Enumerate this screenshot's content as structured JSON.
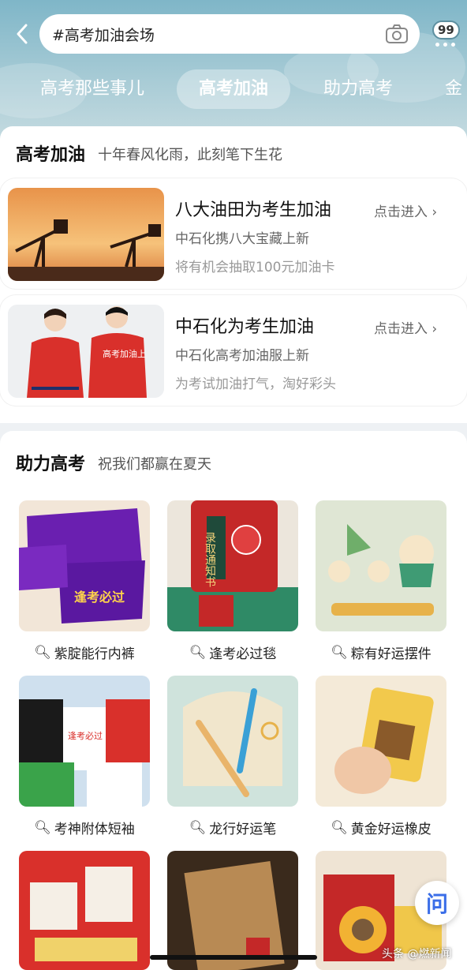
{
  "search": {
    "value": "#高考加油会场",
    "placeholder": ""
  },
  "notification_count": "99",
  "tabs": [
    {
      "label": "高考那些事儿",
      "active": false
    },
    {
      "label": "高考加油",
      "active": true
    },
    {
      "label": "助力高考",
      "active": false
    },
    {
      "label": "金",
      "active": false
    }
  ],
  "section1": {
    "title": "高考加油",
    "subtitle": "十年春风化雨，此刻笔下生花",
    "promos": [
      {
        "title": "八大油田为考生加油",
        "subtitle": "中石化携八大宝藏上新",
        "desc": "将有机会抽取100元加油卡",
        "enter": "点击进入",
        "image": "oil-field-sunset"
      },
      {
        "title": "中石化为考生加油",
        "subtitle": "中石化高考加油服上新",
        "desc": "为考试加油打气，淘好彩头",
        "enter": "点击进入",
        "image": "red-polo-shirts",
        "shirt_text": "高考加油上"
      }
    ]
  },
  "section2": {
    "title": "助力高考",
    "subtitle": "祝我们都赢在夏天",
    "items": [
      {
        "label": "紫腚能行内裤",
        "image": "purple-underwear",
        "img_text": "逢考必过"
      },
      {
        "label": "逢考必过毯",
        "image": "red-blanket",
        "img_text": "录取通知书"
      },
      {
        "label": "粽有好运摆件",
        "image": "zongzi-figures"
      },
      {
        "label": "考神附体短袖",
        "image": "tshirts-group",
        "img_text": "逢考必过"
      },
      {
        "label": "龙行好运笔",
        "image": "lucky-pens"
      },
      {
        "label": "黄金好运橡皮",
        "image": "gold-eraser"
      },
      {
        "label": "",
        "image": "red-gift-box"
      },
      {
        "label": "",
        "image": "brown-notebook"
      },
      {
        "label": "",
        "image": "sunflower-charm"
      }
    ]
  },
  "qa_button_label": "问",
  "watermark": "头条 @燃新闻",
  "colors": {
    "header": "#8bbccb",
    "accent_red": "#d9302b",
    "purple": "#6a1fb0"
  }
}
